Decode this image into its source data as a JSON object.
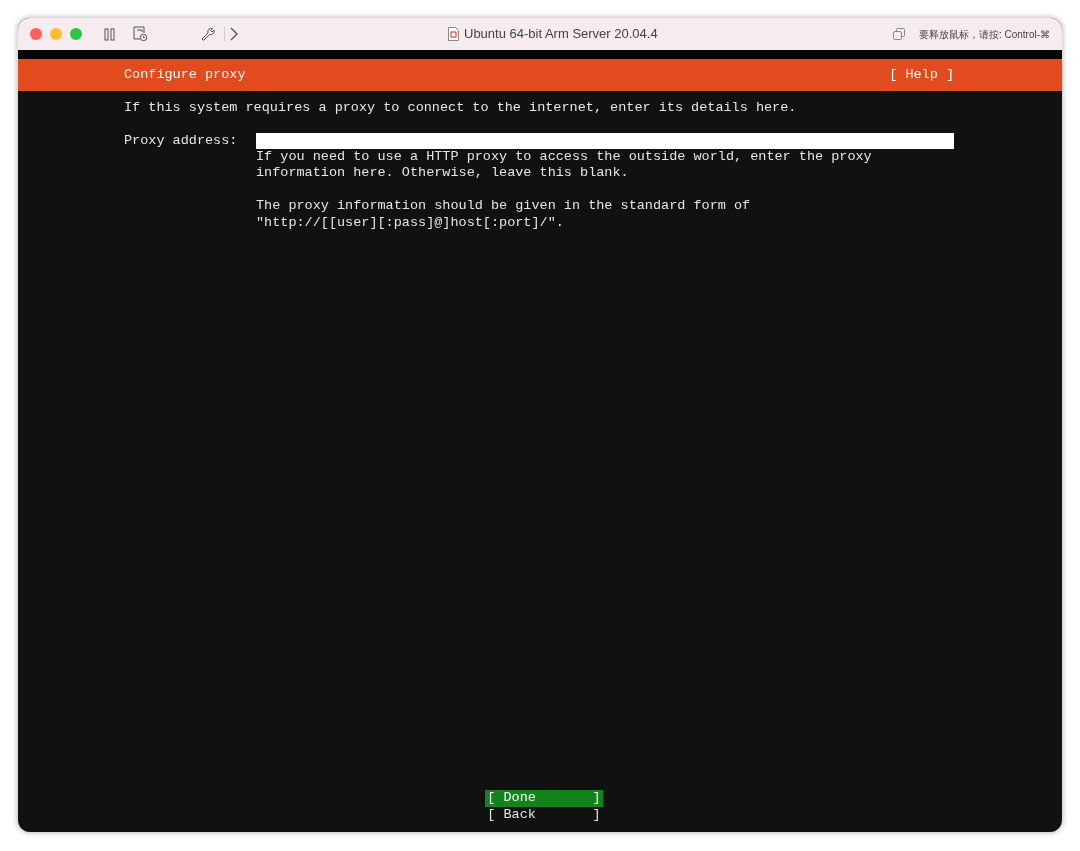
{
  "window": {
    "title": "Ubuntu 64-bit Arm Server 20.04.4",
    "hint": "要释放鼠标，请按: Control-⌘"
  },
  "header": {
    "title": "Configure proxy",
    "help": "[ Help ]"
  },
  "intro": "If this system requires a proxy to connect to the internet, enter its details here.",
  "field": {
    "label": "Proxy address:",
    "help": [
      [
        "If you need to use a HTTP proxy to access the outside world, enter the proxy",
        "information here. Otherwise, leave this blank."
      ],
      [
        "The proxy information should be given in the standard form of",
        "\"http://[[user][:pass]@]host[:port]/\"."
      ]
    ]
  },
  "buttons": [
    {
      "label": "[ Done       ]",
      "selected": true
    },
    {
      "label": "[ Back       ]",
      "selected": false
    }
  ]
}
